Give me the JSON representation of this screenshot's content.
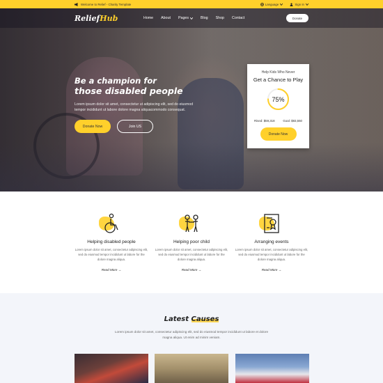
{
  "topbar": {
    "welcome": "Welcome to Relief - Charity Template",
    "language": "Language",
    "signin": "Sign In"
  },
  "header": {
    "logo_main": "Relief",
    "logo_accent": "Hub",
    "nav": [
      "Home",
      "About",
      "Pages",
      "Blog",
      "Shop",
      "Contact"
    ],
    "donate": "Donate"
  },
  "hero": {
    "title_line1": "Be a champion for",
    "title_line2_pre": "those ",
    "title_line2_hl": "disabled people",
    "description": "Lorem ipsum dolor sit amet, consectetur ut adipiscing elit, sed do eiusmod tempor incididunt ut labore dolore magna aliquacommodo consequat.",
    "btn_donate": "Donate Now",
    "btn_join": "Join US"
  },
  "donation_card": {
    "subtitle": "Help Kids Who Never",
    "title": "Get a Chance to Play",
    "percent": "75%",
    "progress": 0.75,
    "raised_label": "Rised",
    "raised_value": "$59,318",
    "goal_label": "Goal",
    "goal_value": "$83,550",
    "button": "Donate Now"
  },
  "features": [
    {
      "title": "Helping disabled people",
      "desc": "Lorem ipsum dolor sit amet, consectetur adipiscing elit, sed do eiusmod tempor incididunt ut labore for the dolore magna aliqua.",
      "more": "Read More"
    },
    {
      "title": "Helping poor child",
      "desc": "Lorem ipsum dolor sit amet, consectetur adipiscing elit, sed do eiusmod tempor incididunt ut labore for the dolore magna aliqua.",
      "more": "Read More"
    },
    {
      "title": "Arranging events",
      "desc": "Lorem ipsum dolor sit amet, consectetur adipiscing elit, sed do eiusmod tempor incididunt ut labore for the dolore magna aliqua.",
      "more": "Read More"
    }
  ],
  "causes": {
    "title_pre": "Latest ",
    "title_hl": "Causes",
    "description": "Lorem ipsum dolor sit amet, consectetur adipiscing elit, sed do eiusmod tempor incididunt ut labore et dolore magna aliqua. Ut enim ad minim veniam."
  },
  "colors": {
    "accent": "#ffd02b",
    "footer_bg": "#f3f5fa"
  }
}
